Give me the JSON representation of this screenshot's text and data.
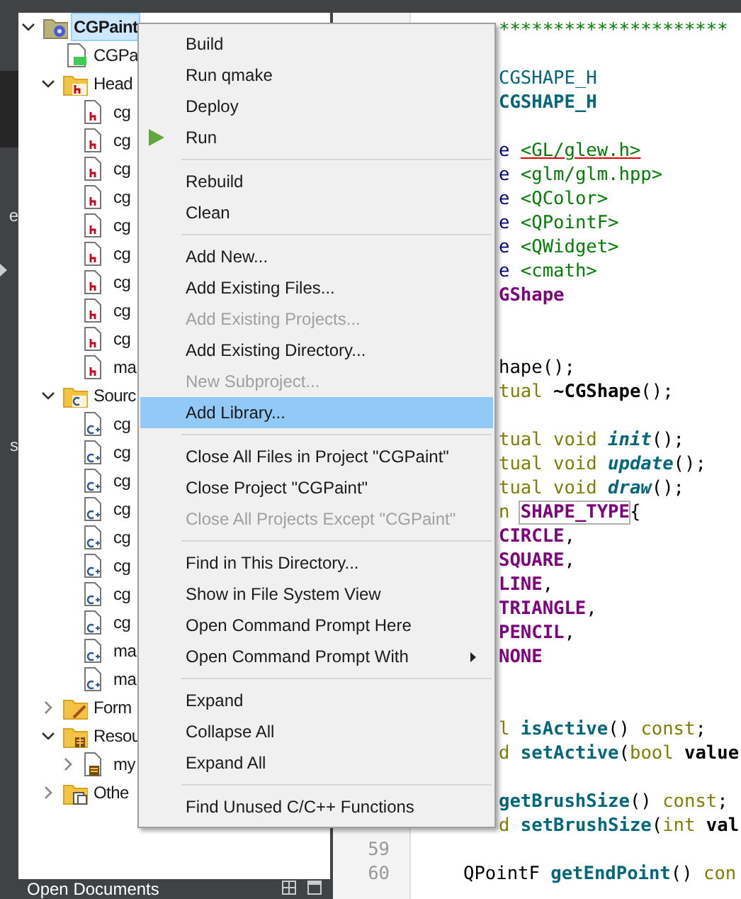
{
  "mode_bar": {
    "labels": [
      "e",
      "s"
    ]
  },
  "project_tree": [
    {
      "label": "CGPaint",
      "kind": "project",
      "expanded": true,
      "selected": true,
      "children": [
        {
          "label": "CGPa",
          "kind": "pro_file",
          "selected": false
        },
        {
          "label": "Head",
          "kind": "headers_folder",
          "expanded": true,
          "selected": false,
          "children": [
            {
              "label": "cg",
              "kind": "header",
              "selected": false
            },
            {
              "label": "cg",
              "kind": "header",
              "selected": false
            },
            {
              "label": "cg",
              "kind": "header",
              "selected": false
            },
            {
              "label": "cg",
              "kind": "header",
              "selected": false
            },
            {
              "label": "cg",
              "kind": "header",
              "selected": false
            },
            {
              "label": "cg",
              "kind": "header",
              "selected": false
            },
            {
              "label": "cg",
              "kind": "header",
              "selected": false
            },
            {
              "label": "cg",
              "kind": "header",
              "selected": false
            },
            {
              "label": "cg",
              "kind": "header",
              "selected": false
            },
            {
              "label": "ma",
              "kind": "header",
              "selected": false
            }
          ]
        },
        {
          "label": "Sourc",
          "kind": "sources_folder",
          "expanded": true,
          "selected": false,
          "children": [
            {
              "label": "cg",
              "kind": "source",
              "selected": false
            },
            {
              "label": "cg",
              "kind": "source",
              "selected": false
            },
            {
              "label": "cg",
              "kind": "source",
              "selected": false
            },
            {
              "label": "cg",
              "kind": "source",
              "selected": false
            },
            {
              "label": "cg",
              "kind": "source",
              "selected": false
            },
            {
              "label": "cg",
              "kind": "source",
              "selected": false
            },
            {
              "label": "cg",
              "kind": "source",
              "selected": false
            },
            {
              "label": "cg",
              "kind": "source",
              "selected": false
            },
            {
              "label": "ma",
              "kind": "source",
              "selected": false
            },
            {
              "label": "ma",
              "kind": "source",
              "selected": false
            }
          ]
        },
        {
          "label": "Form",
          "kind": "forms_folder",
          "expanded": false,
          "selected": false
        },
        {
          "label": "Resou",
          "kind": "resources_folder",
          "expanded": true,
          "selected": false,
          "children": [
            {
              "label": "my",
              "kind": "resource",
              "expanded": false,
              "selected": false
            }
          ]
        },
        {
          "label": "Othe",
          "kind": "other_folder",
          "expanded": false,
          "selected": false
        }
      ]
    }
  ],
  "bottom_panel": {
    "title": "Open Documents"
  },
  "editor": {
    "lines": [
      {
        "kind": "code",
        "tokens": [
          {
            "text": "*********************",
            "kind": "comment"
          }
        ]
      },
      {
        "kind": "blank"
      },
      {
        "kind": "code",
        "tokens": [
          {
            "text": "CGSHAPE_H",
            "kind": "macro"
          }
        ]
      },
      {
        "kind": "code",
        "tokens": [
          {
            "text": "CGSHAPE_H",
            "kind": "macro_def"
          }
        ]
      },
      {
        "kind": "blank"
      },
      {
        "kind": "code",
        "tokens": [
          {
            "text": "e ",
            "kind": "preproc"
          },
          {
            "text": "<GL/glew.h>",
            "kind": "string_error"
          }
        ]
      },
      {
        "kind": "code",
        "tokens": [
          {
            "text": "e ",
            "kind": "preproc"
          },
          {
            "text": "<glm/glm.hpp>",
            "kind": "string"
          }
        ]
      },
      {
        "kind": "code",
        "tokens": [
          {
            "text": "e ",
            "kind": "preproc"
          },
          {
            "text": "<QColor>",
            "kind": "string"
          }
        ]
      },
      {
        "kind": "code",
        "tokens": [
          {
            "text": "e ",
            "kind": "preproc"
          },
          {
            "text": "<QPointF>",
            "kind": "string"
          }
        ]
      },
      {
        "kind": "code",
        "tokens": [
          {
            "text": "e ",
            "kind": "preproc"
          },
          {
            "text": "<QWidget>",
            "kind": "string"
          }
        ]
      },
      {
        "kind": "code",
        "tokens": [
          {
            "text": "e ",
            "kind": "preproc"
          },
          {
            "text": "<cmath>",
            "kind": "string"
          }
        ]
      },
      {
        "kind": "code",
        "tokens": [
          {
            "text": "GShape",
            "kind": "type"
          }
        ]
      },
      {
        "kind": "blank"
      },
      {
        "kind": "blank"
      },
      {
        "kind": "code",
        "tokens": [
          {
            "text": "hape();",
            "kind": "plain"
          }
        ]
      },
      {
        "kind": "code",
        "tokens": [
          {
            "text": "tual ",
            "kind": "keyword"
          },
          {
            "text": "~CGShape",
            "kind": "decl"
          },
          {
            "text": "();",
            "kind": "plain"
          }
        ]
      },
      {
        "kind": "blank"
      },
      {
        "kind": "code",
        "tokens": [
          {
            "text": "tual void ",
            "kind": "keyword"
          },
          {
            "text": "init",
            "kind": "virtual"
          },
          {
            "text": "();",
            "kind": "plain"
          }
        ]
      },
      {
        "kind": "code",
        "tokens": [
          {
            "text": "tual void ",
            "kind": "keyword"
          },
          {
            "text": "update",
            "kind": "virtual"
          },
          {
            "text": "();",
            "kind": "plain"
          }
        ]
      },
      {
        "kind": "code",
        "tokens": [
          {
            "text": "tual void ",
            "kind": "keyword"
          },
          {
            "text": "draw",
            "kind": "virtual"
          },
          {
            "text": "();",
            "kind": "plain"
          }
        ]
      },
      {
        "kind": "code",
        "tokens": [
          {
            "text": "n ",
            "kind": "keyword"
          },
          {
            "text": "SHAPE_TYPE",
            "kind": "type_boxed"
          },
          {
            "text": "{",
            "kind": "plain"
          }
        ]
      },
      {
        "kind": "code",
        "tokens": [
          {
            "text": "CIRCLE",
            "kind": "enum"
          },
          {
            "text": ",",
            "kind": "plain"
          }
        ]
      },
      {
        "kind": "code",
        "tokens": [
          {
            "text": "SQUARE",
            "kind": "enum"
          },
          {
            "text": ",",
            "kind": "plain"
          }
        ]
      },
      {
        "kind": "code",
        "tokens": [
          {
            "text": "LINE",
            "kind": "enum"
          },
          {
            "text": ",",
            "kind": "plain"
          }
        ]
      },
      {
        "kind": "code",
        "tokens": [
          {
            "text": "TRIANGLE",
            "kind": "enum"
          },
          {
            "text": ",",
            "kind": "plain"
          }
        ]
      },
      {
        "kind": "code",
        "tokens": [
          {
            "text": "PENCIL",
            "kind": "enum"
          },
          {
            "text": ",",
            "kind": "plain"
          }
        ]
      },
      {
        "kind": "code",
        "tokens": [
          {
            "text": "NONE",
            "kind": "enum"
          }
        ]
      },
      {
        "kind": "blank"
      },
      {
        "kind": "blank"
      },
      {
        "kind": "code",
        "tokens": [
          {
            "text": "l ",
            "kind": "keyword"
          },
          {
            "text": "isActive",
            "kind": "func"
          },
          {
            "text": "() ",
            "kind": "plain"
          },
          {
            "text": "const",
            "kind": "keyword"
          },
          {
            "text": ";",
            "kind": "plain"
          }
        ]
      },
      {
        "kind": "code",
        "tokens": [
          {
            "text": "d ",
            "kind": "keyword"
          },
          {
            "text": "setActive",
            "kind": "func"
          },
          {
            "text": "(",
            "kind": "plain"
          },
          {
            "text": "bool ",
            "kind": "keyword"
          },
          {
            "text": "value",
            "kind": "decl"
          }
        ]
      },
      {
        "kind": "blank"
      },
      {
        "kind": "code",
        "tokens": [
          {
            "text": "getBrushSize",
            "kind": "func"
          },
          {
            "text": "() ",
            "kind": "plain"
          },
          {
            "text": "const",
            "kind": "keyword"
          },
          {
            "text": ";",
            "kind": "plain"
          }
        ]
      },
      {
        "kind": "code",
        "tokens": [
          {
            "text": "d ",
            "kind": "keyword"
          },
          {
            "text": "setBrushSize",
            "kind": "func"
          },
          {
            "text": "(",
            "kind": "plain"
          },
          {
            "text": "int ",
            "kind": "keyword"
          },
          {
            "text": "val",
            "kind": "decl"
          }
        ]
      },
      {
        "kind": "blank",
        "line_number": "59"
      },
      {
        "kind": "code",
        "line_number": "60",
        "tokens": [
          {
            "text": "QPointF ",
            "kind": "plain"
          },
          {
            "text": "getEndPoint",
            "kind": "func"
          },
          {
            "text": "() ",
            "kind": "plain"
          },
          {
            "text": "con",
            "kind": "keyword"
          }
        ]
      }
    ]
  },
  "context_menu": {
    "items": [
      {
        "kind": "action",
        "label": "Build",
        "disabled": false,
        "selected": false,
        "submenu": false
      },
      {
        "kind": "action",
        "label": "Run qmake",
        "disabled": false,
        "selected": false,
        "submenu": false
      },
      {
        "kind": "action",
        "label": "Deploy",
        "disabled": false,
        "selected": false,
        "submenu": false
      },
      {
        "kind": "run_action",
        "label": "Run",
        "disabled": false,
        "selected": false,
        "submenu": false
      },
      {
        "kind": "separator"
      },
      {
        "kind": "action",
        "label": "Rebuild",
        "disabled": false,
        "selected": false,
        "submenu": false
      },
      {
        "kind": "action",
        "label": "Clean",
        "disabled": false,
        "selected": false,
        "submenu": false
      },
      {
        "kind": "separator"
      },
      {
        "kind": "action",
        "label": "Add New...",
        "disabled": false,
        "selected": false,
        "submenu": false
      },
      {
        "kind": "action",
        "label": "Add Existing Files...",
        "disabled": false,
        "selected": false,
        "submenu": false
      },
      {
        "kind": "action",
        "label": "Add Existing Projects...",
        "disabled": true,
        "selected": false,
        "submenu": false
      },
      {
        "kind": "action",
        "label": "Add Existing Directory...",
        "disabled": false,
        "selected": false,
        "submenu": false
      },
      {
        "kind": "action",
        "label": "New Subproject...",
        "disabled": true,
        "selected": false,
        "submenu": false
      },
      {
        "kind": "action",
        "label": "Add Library...",
        "disabled": false,
        "selected": true,
        "submenu": false
      },
      {
        "kind": "separator"
      },
      {
        "kind": "action",
        "label": "Close All Files in Project \"CGPaint\"",
        "disabled": false,
        "selected": false,
        "submenu": false
      },
      {
        "kind": "action",
        "label": "Close Project \"CGPaint\"",
        "disabled": false,
        "selected": false,
        "submenu": false
      },
      {
        "kind": "action",
        "label": "Close All Projects Except \"CGPaint\"",
        "disabled": true,
        "selected": false,
        "submenu": false
      },
      {
        "kind": "separator"
      },
      {
        "kind": "action",
        "label": "Find in This Directory...",
        "disabled": false,
        "selected": false,
        "submenu": false
      },
      {
        "kind": "action",
        "label": "Show in File System View",
        "disabled": false,
        "selected": false,
        "submenu": false
      },
      {
        "kind": "action",
        "label": "Open Command Prompt Here",
        "disabled": false,
        "selected": false,
        "submenu": false
      },
      {
        "kind": "action",
        "label": "Open Command Prompt With",
        "disabled": false,
        "selected": false,
        "submenu": true
      },
      {
        "kind": "separator"
      },
      {
        "kind": "action",
        "label": "Expand",
        "disabled": false,
        "selected": false,
        "submenu": false
      },
      {
        "kind": "action",
        "label": "Collapse All",
        "disabled": false,
        "selected": false,
        "submenu": false
      },
      {
        "kind": "action",
        "label": "Expand All",
        "disabled": false,
        "selected": false,
        "submenu": false
      },
      {
        "kind": "separator"
      },
      {
        "kind": "action",
        "label": "Find Unused C/C++ Functions",
        "disabled": false,
        "selected": false,
        "submenu": false
      }
    ]
  }
}
